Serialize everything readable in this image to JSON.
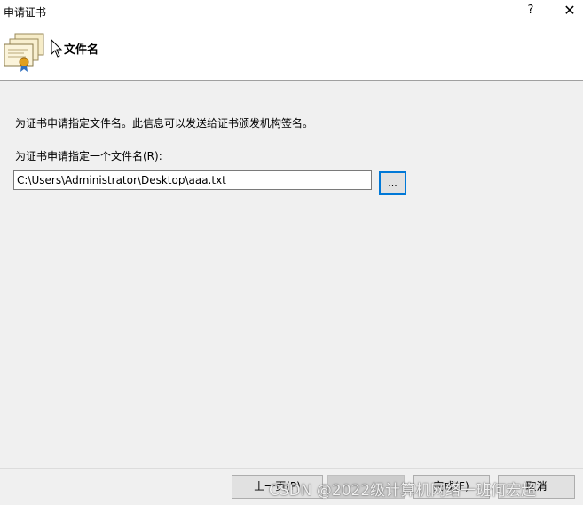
{
  "window": {
    "title": "申请证书",
    "help_label": "?",
    "close_label": "✕"
  },
  "header": {
    "title": "文件名",
    "icon": "certificate-icon"
  },
  "main": {
    "description": "为证书申请指定文件名。此信息可以发送给证书颁发机构签名。",
    "field_label": "为证书申请指定一个文件名(R):",
    "filename_value": "C:\\Users\\Administrator\\Desktop\\aaa.txt",
    "browse_label": "..."
  },
  "footer": {
    "back_label": "上一页(P)",
    "next_label": "",
    "finish_label": "完成(F)",
    "cancel_label": "取消"
  },
  "watermark": "CSDN @2022级计算机网络一班何宏超",
  "colors": {
    "accent": "#0078d7",
    "header_bg": "#ffffff",
    "body_bg": "#f0f0f0"
  }
}
